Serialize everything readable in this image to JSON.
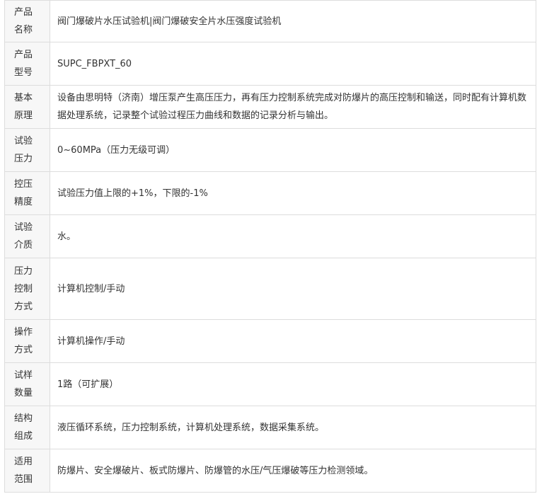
{
  "rows": [
    {
      "label": "产品名称",
      "value": "阀门爆破片水压试验机|阀门爆破安全片水压强度试验机"
    },
    {
      "label": "产品型号",
      "value": "SUPC_FBPXT_60"
    },
    {
      "label": "基本原理",
      "value": "设备由思明特（济南）增压泵产生高压压力，再有压力控制系统完成对防爆片的高压控制和输送，同时配有计算机数据处理系统，记录整个试验过程压力曲线和数据的记录分析与输出。"
    },
    {
      "label": "试验压力",
      "value": "0~60MPa（压力无级可调）"
    },
    {
      "label": "控压精度",
      "value": "试验压力值上限的+1%，下限的-1%"
    },
    {
      "label": "试验介质",
      "value": "水。"
    },
    {
      "label": "压力控制方式",
      "value": "计算机控制/手动"
    },
    {
      "label": "操作方式",
      "value": "计算机操作/手动"
    },
    {
      "label": "试样数量",
      "value": "1路（可扩展）"
    },
    {
      "label": "结构组成",
      "value": "液压循环系统，压力控制系统，计算机处理系统，数据采集系统。"
    },
    {
      "label": "适用范围",
      "value": "防爆片、安全爆破片、板式防爆片、防爆管的水压/气压爆破等压力检测领域。"
    }
  ]
}
